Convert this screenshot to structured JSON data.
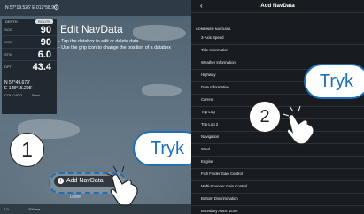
{
  "topbar": {
    "position": "N 57°19.526' E 012°58.9",
    "gear_icon": "gear-icon"
  },
  "databox": {
    "header_left": "DEPTH",
    "header_right": "ROUTE",
    "rows": [
      {
        "value": "90",
        "label": "SOG"
      },
      {
        "value": "90",
        "label": "COG"
      },
      {
        "value": "6.0",
        "label": "STW"
      },
      {
        "value": "43.4",
        "label": "DPT"
      }
    ],
    "position_line1": "N 57°49.679'",
    "position_line2": "E 148°15.205'",
    "misc_left": "COL / VDO",
    "misc_right": "Back"
  },
  "overlay": {
    "title": "Edit NavData",
    "instructions": [
      "- Tap the databox to edit or delete data",
      "- Use the grip icon to change the position of a databox"
    ],
    "add_button_label": "Add NavData",
    "done_label": "Done"
  },
  "callouts": {
    "step1": "1",
    "step2": "2",
    "tap1": "Tryk",
    "tap2": "Tryk"
  },
  "bottom_bar": {
    "left": "0.0",
    "right": "...",
    "scale": "200 nm"
  },
  "panel": {
    "back_icon": "chevron-left-icon",
    "title": "Add NavData",
    "section": "COMBINED NAVDATA",
    "items": [
      "3-Axis Speed",
      "Tide Information",
      "Weather Information",
      "Highway",
      "Date Information",
      "Current",
      "Trip Log",
      "Trip Log 2",
      "Navigation",
      "Wind",
      "Engine",
      "Fish Finder Gain Control",
      "Multi-Sounder Gain Control",
      "Bottom Discrimination",
      "Boundary Alarm Zone",
      "Drag Zone"
    ]
  },
  "colors": {
    "accent": "#1e6fb8",
    "panel_bg": "#181c21"
  }
}
